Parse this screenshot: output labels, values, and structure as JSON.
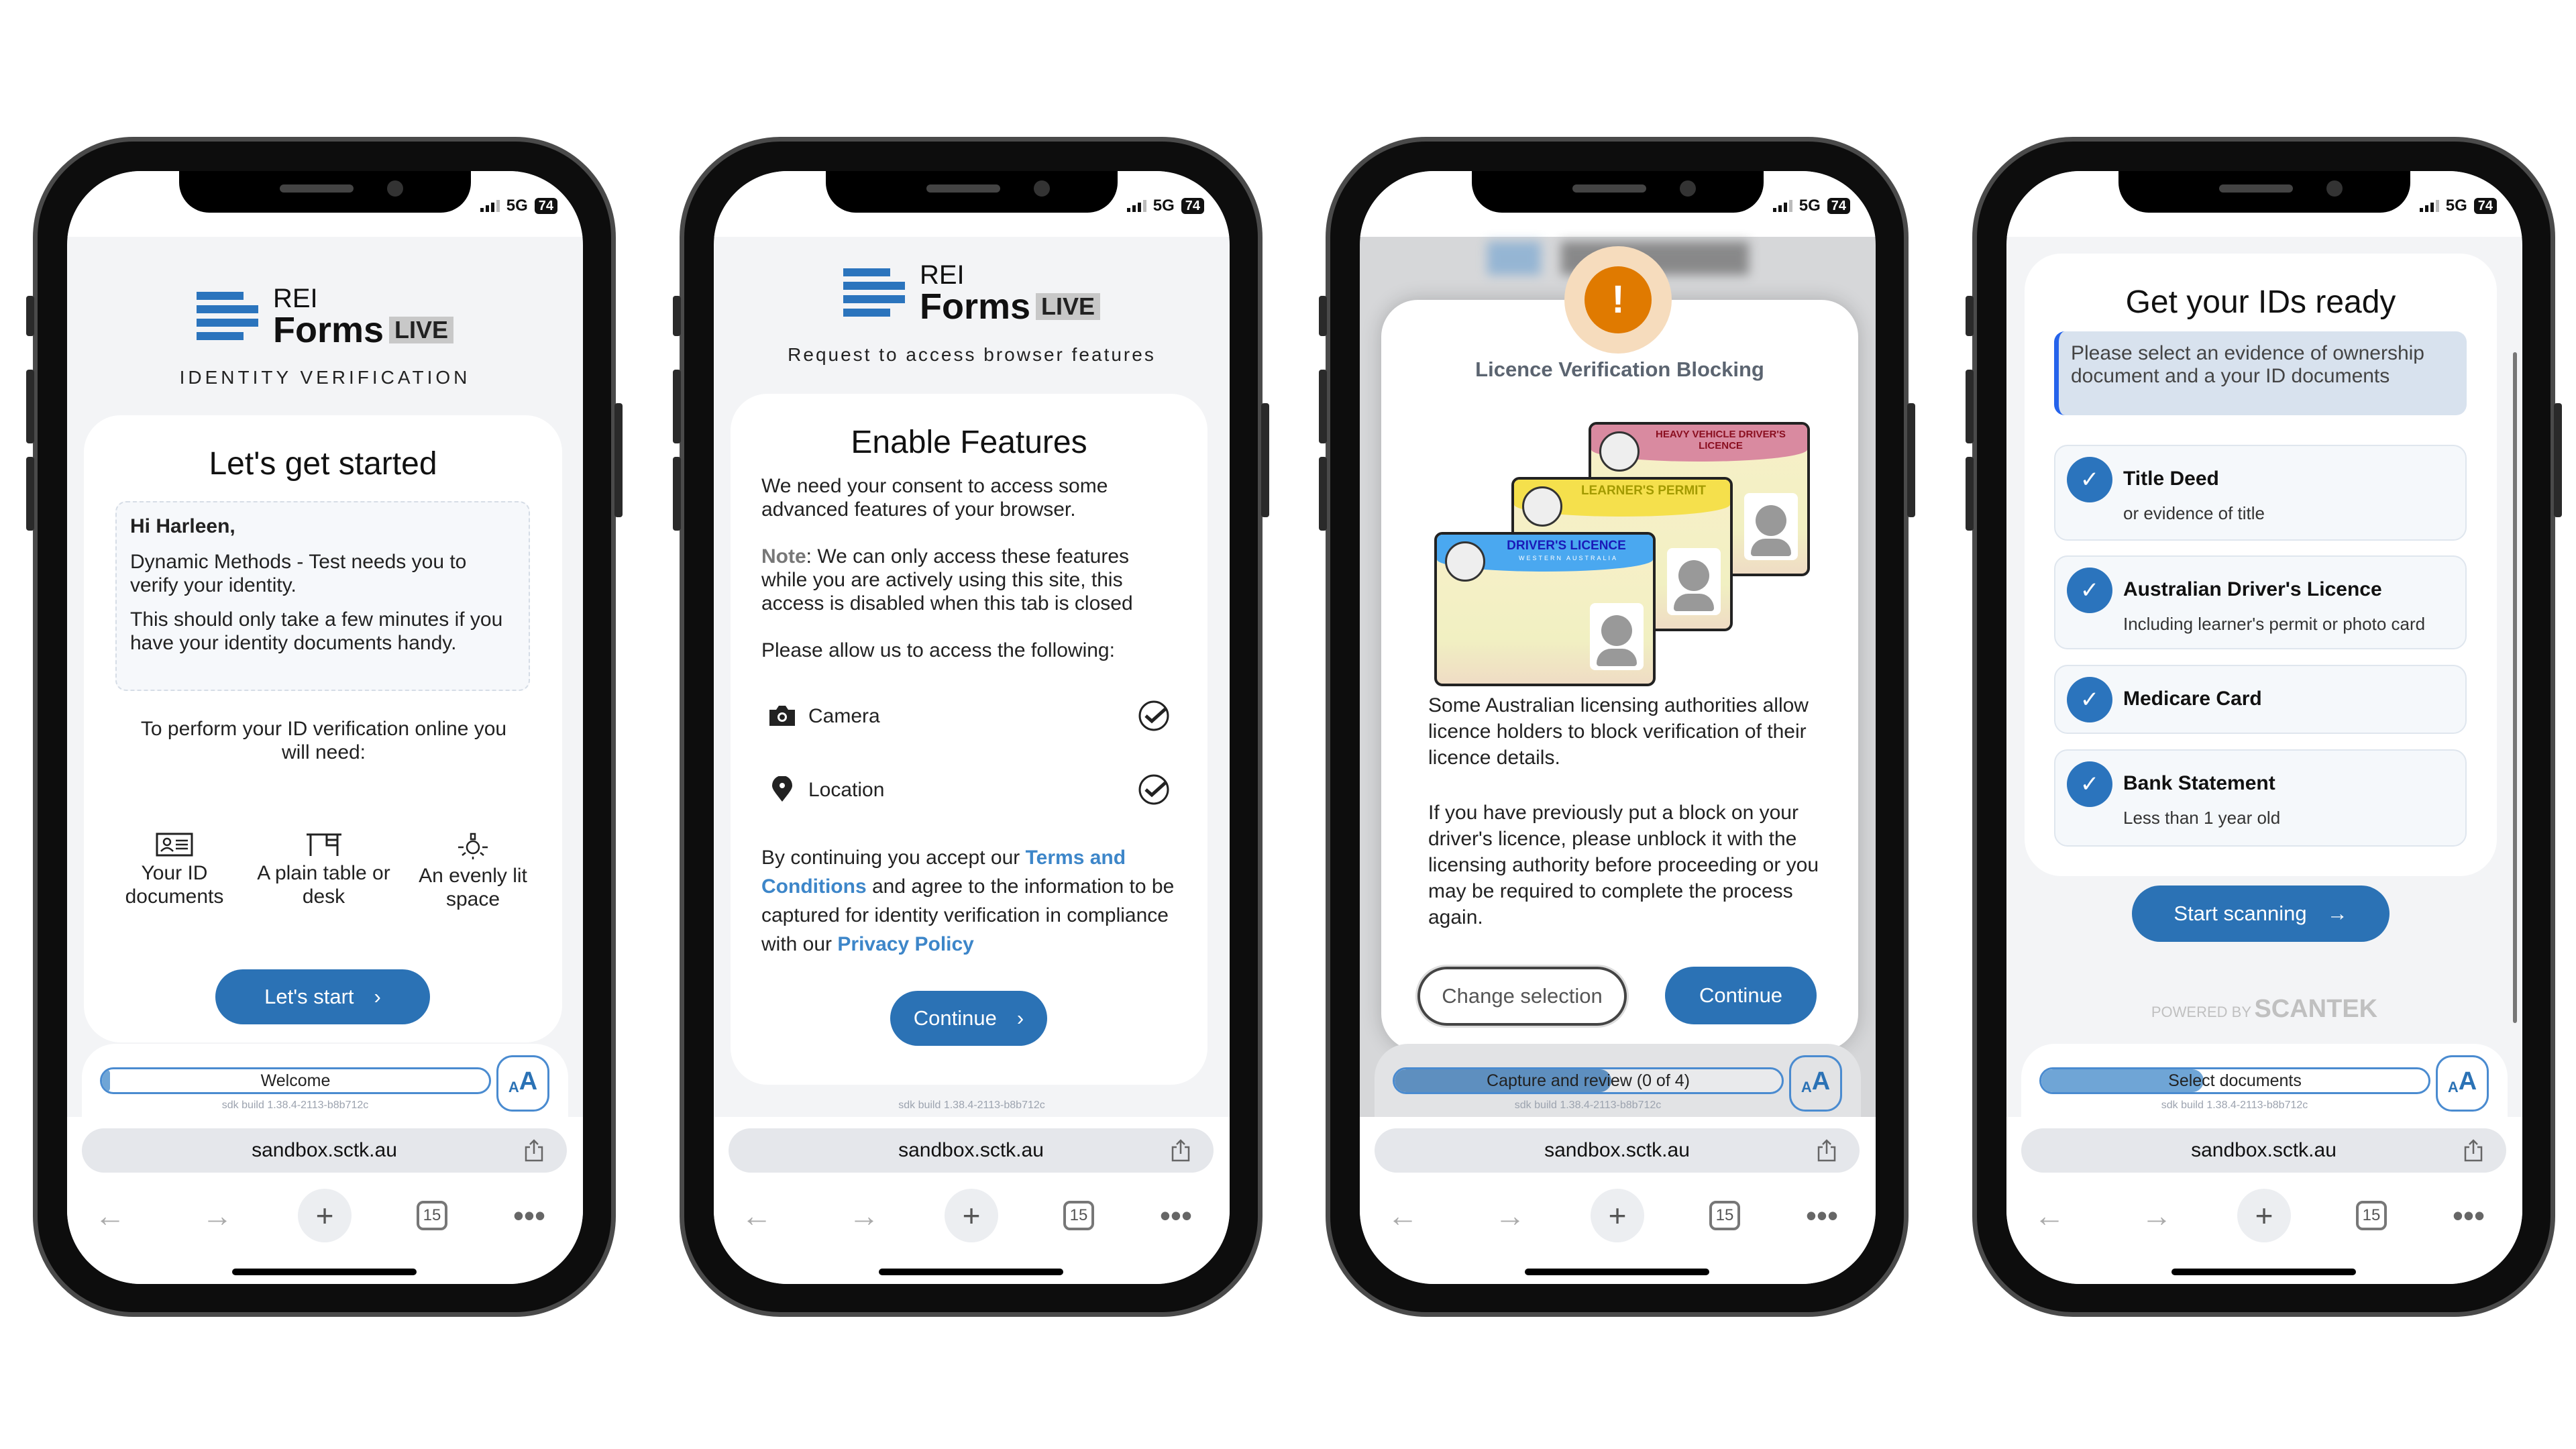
{
  "common": {
    "signal": "5G",
    "battery": "74",
    "url": "sandbox.sctk.au",
    "sdk_build": "sdk build 1.38.4-2113-b8b712c",
    "tabs_count": "15",
    "aa_label": "AA",
    "accent": "#2b72b5",
    "logo": {
      "rei": "REI",
      "forms": "Forms",
      "live": "LIVE"
    }
  },
  "phone1": {
    "subtitle": "IDENTITY VERIFICATION",
    "title": "Let's get started",
    "greeting": "Hi Harleen,",
    "message1": "Dynamic Methods - Test needs you to verify your identity.",
    "message2": "This should only take a few minutes if you have your identity documents handy.",
    "need_text": "To perform your ID verification online you will need:",
    "needs": [
      {
        "icon": "id-card-icon",
        "label": "Your ID documents"
      },
      {
        "icon": "desk-icon",
        "label": "A plain table or desk"
      },
      {
        "icon": "light-bulb-icon",
        "label": "An evenly lit space"
      }
    ],
    "button": "Let's start",
    "progress_label": "Welcome",
    "progress": 0.02
  },
  "phone2": {
    "subtitle": "Request to access browser features",
    "title": "Enable Features",
    "intro": "We need your consent to access some advanced features of your browser.",
    "note_label": "Note",
    "note_text": ": We can only access these features while you are actively using this site, this access is disabled when this tab is closed",
    "allow_text": "Please allow us to access the following:",
    "features": [
      {
        "icon": "camera-icon",
        "label": "Camera",
        "granted": true
      },
      {
        "icon": "location-pin-icon",
        "label": "Location",
        "granted": true
      }
    ],
    "consent_1": "By continuing you accept our ",
    "terms_link": "Terms and Conditions",
    "consent_2": " and agree to the information to be captured for identity verification in compliance with our ",
    "privacy_link": "Privacy Policy",
    "button": "Continue"
  },
  "phone3": {
    "modal_title": "Licence Verification Blocking",
    "cards": [
      {
        "title": "HEAVY VEHICLE DRIVER'S LICENCE",
        "color": "#d98aa0"
      },
      {
        "title": "LEARNER'S PERMIT",
        "color": "#f5e04c"
      },
      {
        "title": "DRIVER'S LICENCE",
        "color": "#4aa8f0"
      }
    ],
    "card_subtitle": "WESTERN AUSTRALIA",
    "para1": "Some Australian licensing authorities allow licence holders to block verification of their licence details.",
    "para2": "If you have previously put a block on your driver's licence, please unblock it with the licensing authority before proceeding or you may be required to complete the process again.",
    "change_button": "Change selection",
    "continue_button": "Continue",
    "progress_label": "Capture and review (0 of 4)",
    "progress": 0.56,
    "warning_color": "#e07a00"
  },
  "phone4": {
    "title": "Get your IDs ready",
    "info": "Please select an evidence of ownership document and a your ID documents",
    "items": [
      {
        "title": "Title Deed",
        "sub": "or evidence of title",
        "checked": true
      },
      {
        "title": "Australian Driver's Licence",
        "sub": "Including learner's permit or photo card",
        "checked": true
      },
      {
        "title": "Medicare Card",
        "sub": "",
        "checked": true
      },
      {
        "title": "Bank Statement",
        "sub": "Less than 1 year old",
        "checked": true
      }
    ],
    "button": "Start scanning",
    "powered_by": "POWERED BY",
    "powered_brand": "SCANTEK",
    "progress_label": "Select documents",
    "progress": 0.42
  }
}
